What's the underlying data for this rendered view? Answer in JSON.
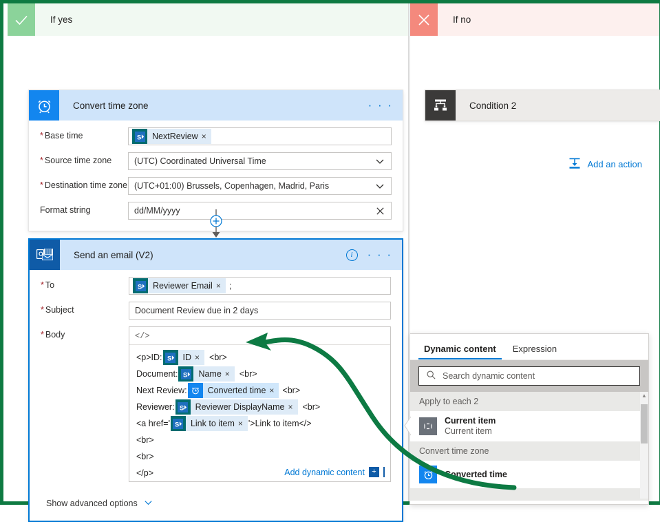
{
  "branches": {
    "yes": {
      "label": "If yes",
      "icon": "check-icon"
    },
    "no": {
      "label": "If no",
      "icon": "close-icon"
    }
  },
  "convert_card": {
    "title": "Convert time zone",
    "icon": "alarm-clock-icon",
    "menu": "· · ·",
    "fields": [
      {
        "label": "Base time",
        "required": true,
        "type": "token",
        "token": {
          "label": "NextReview",
          "icon": "sharepoint-icon",
          "remove": "×"
        }
      },
      {
        "label": "Source time zone",
        "required": true,
        "type": "dropdown",
        "value": "(UTC) Coordinated Universal Time"
      },
      {
        "label": "Destination time zone",
        "required": true,
        "type": "dropdown",
        "value": "(UTC+01:00) Brussels, Copenhagen, Madrid, Paris"
      },
      {
        "label": "Format string",
        "required": false,
        "type": "clearable",
        "value": "dd/MM/yyyy"
      }
    ]
  },
  "connector": {
    "add_icon": "plus-circle-icon"
  },
  "email_card": {
    "title": "Send an email (V2)",
    "icon": "outlook-icon",
    "info": "i",
    "menu": "· · ·",
    "to": {
      "label": "To",
      "required": true,
      "token": {
        "label": "Reviewer Email",
        "icon": "sharepoint-icon",
        "remove": "×"
      },
      "trailing": ";"
    },
    "subject": {
      "label": "Subject",
      "required": true,
      "value": "Document Review due in 2 days"
    },
    "body": {
      "label": "Body",
      "required": true,
      "toolbar_icon": "</>",
      "lines": [
        {
          "pre": "<p>ID: ",
          "token": {
            "label": "ID",
            "icon": "sharepoint-icon",
            "remove": "×"
          },
          "post": "<br>"
        },
        {
          "pre": "Document: ",
          "token": {
            "label": "Name",
            "icon": "sharepoint-icon",
            "remove": "×"
          },
          "post": "<br>"
        },
        {
          "pre": "Next Review: ",
          "token": {
            "label": "Converted time",
            "icon": "alarm-clock-icon",
            "remove": "×",
            "highlight": true
          },
          "post": "<br>"
        },
        {
          "pre": "Reviewer: ",
          "token": {
            "label": "Reviewer DisplayName",
            "icon": "sharepoint-icon",
            "remove": "×"
          },
          "post": "<br>"
        },
        {
          "pre": "<a href='",
          "token": {
            "label": "Link to item",
            "icon": "sharepoint-icon",
            "remove": "×"
          },
          "post": "'>Link to item</>"
        },
        {
          "pre": "<br>",
          "post": ""
        },
        {
          "pre": "<br>",
          "post": ""
        },
        {
          "pre": "</p>",
          "post": ""
        }
      ],
      "add_dynamic_content": "Add dynamic content"
    },
    "advanced": {
      "label": "Show advanced options",
      "icon": "chevron-down-icon"
    }
  },
  "condition2_card": {
    "title": "Condition 2",
    "icon": "condition-branch-icon"
  },
  "add_action": {
    "label": "Add an action",
    "icon": "add-action-icon"
  },
  "dynamic_panel": {
    "tabs": [
      {
        "label": "Dynamic content",
        "active": true
      },
      {
        "label": "Expression",
        "active": false
      }
    ],
    "search": {
      "placeholder": "Search dynamic content",
      "icon": "search-icon",
      "value": ""
    },
    "groups": [
      {
        "name": "Apply to each 2",
        "items": [
          {
            "title": "Current item",
            "subtitle": "Current item",
            "icon": "current-item-icon",
            "icon_style": "gray"
          }
        ]
      },
      {
        "name": "Convert time zone",
        "items": [
          {
            "title": "Converted time",
            "subtitle": "",
            "icon": "alarm-clock-icon",
            "icon_style": "blue"
          }
        ]
      }
    ]
  },
  "annotation": {
    "type": "curved-arrow",
    "color": "#0D7A43",
    "from": "dynamic-content-converted-time",
    "to": "body-token-converted-time"
  },
  "colors": {
    "frame_green": "#0e7a42",
    "yes_badge": "#8BD39A",
    "yes_header": "#F1F9F2",
    "no_badge": "#F4897D",
    "no_header": "#FDF0EE",
    "card_header_blue": "#CFE4FA",
    "icon_blue": "#1386EF",
    "outlook_blue": "#0F5BA7",
    "accent_link": "#0078D4",
    "required_red": "#A4262C",
    "condition_icon_bg": "#3B3A39",
    "annotation_green": "#0D7A43"
  }
}
